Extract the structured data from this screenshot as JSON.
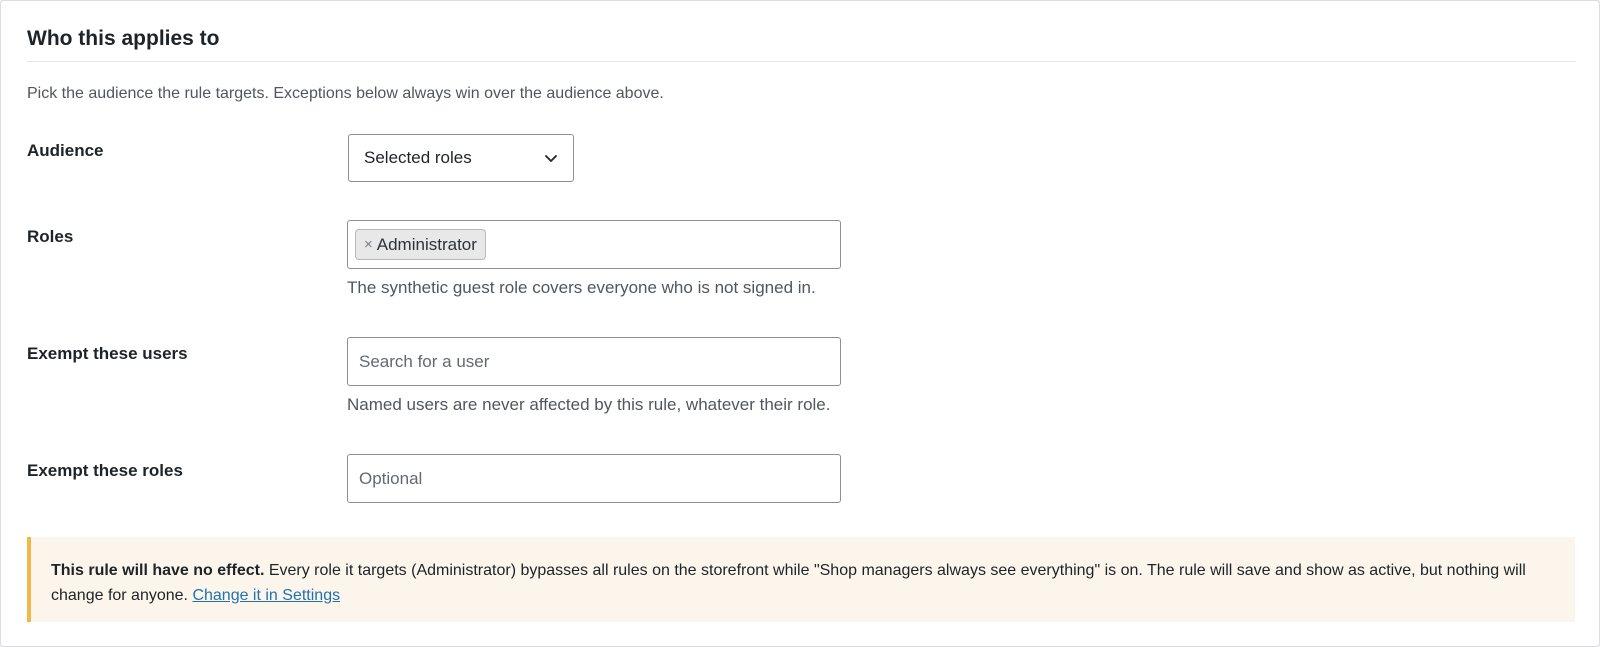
{
  "section": {
    "title": "Who this applies to",
    "intro": "Pick the audience the rule targets. Exceptions below always win over the audience above."
  },
  "audience": {
    "label": "Audience",
    "selected": "Selected roles",
    "icon": "chevron-down-icon"
  },
  "roles": {
    "label": "Roles",
    "chips": [
      "Administrator"
    ],
    "remove_glyph": "×",
    "help": "The synthetic guest role covers everyone who is not signed in."
  },
  "exempt_users": {
    "label": "Exempt these users",
    "placeholder": "Search for a user",
    "help": "Named users are never affected by this rule, whatever their role."
  },
  "exempt_roles": {
    "label": "Exempt these roles",
    "placeholder": "Optional"
  },
  "notice": {
    "strong": "This rule will have no effect.",
    "text": " Every role it targets (Administrator) bypasses all rules on the storefront while \"Shop managers always see everything\" is on. The rule will save and show as active, but nothing will change for anyone. ",
    "link": "Change it in Settings"
  },
  "colors": {
    "notice_bg": "#fcf5ec",
    "notice_border": "#f0b849",
    "link": "#2271b1"
  }
}
